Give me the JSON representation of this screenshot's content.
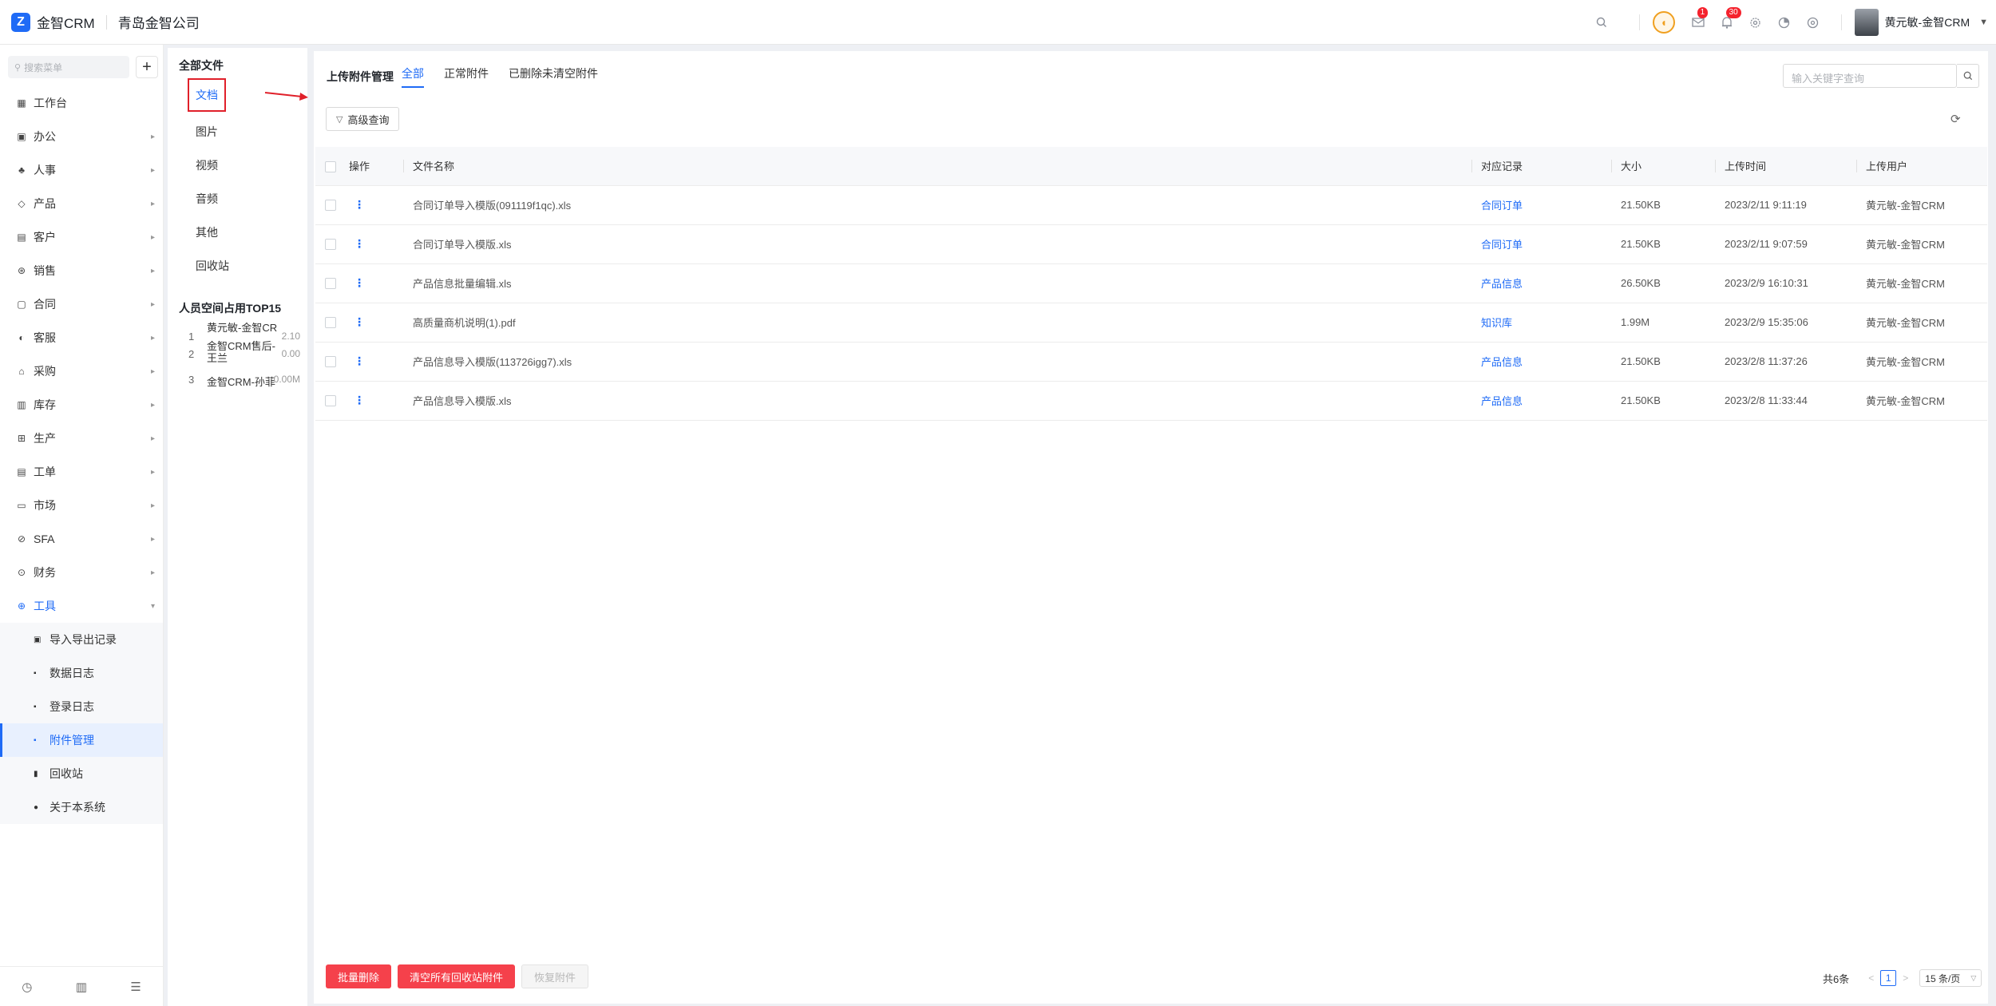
{
  "header": {
    "app_name": "金智CRM",
    "company": "青岛金智公司",
    "badge_messages": "1",
    "badge_notifications": "30",
    "user_name": "黄元敏-金智CRM"
  },
  "leftnav": {
    "search_placeholder": "搜索菜单",
    "add_label": "+",
    "items": [
      {
        "label": "工作台",
        "icon": "dashboard-icon"
      },
      {
        "label": "办公",
        "icon": "office-icon"
      },
      {
        "label": "人事",
        "icon": "hr-icon"
      },
      {
        "label": "产品",
        "icon": "product-icon"
      },
      {
        "label": "客户",
        "icon": "customer-icon"
      },
      {
        "label": "销售",
        "icon": "sales-icon"
      },
      {
        "label": "合同",
        "icon": "contract-icon"
      },
      {
        "label": "客服",
        "icon": "service-icon"
      },
      {
        "label": "采购",
        "icon": "purchase-icon"
      },
      {
        "label": "库存",
        "icon": "inventory-icon"
      },
      {
        "label": "生产",
        "icon": "production-icon"
      },
      {
        "label": "工单",
        "icon": "workorder-icon"
      },
      {
        "label": "市场",
        "icon": "market-icon"
      },
      {
        "label": "SFA",
        "icon": "sfa-icon"
      },
      {
        "label": "财务",
        "icon": "finance-icon"
      },
      {
        "label": "工具",
        "icon": "tools-icon"
      }
    ],
    "sub_items": [
      {
        "label": "导入导出记录"
      },
      {
        "label": "数据日志"
      },
      {
        "label": "登录日志"
      },
      {
        "label": "附件管理"
      },
      {
        "label": "回收站"
      },
      {
        "label": "关于本系统"
      }
    ]
  },
  "folders": {
    "title": "全部文件",
    "items": [
      "文档",
      "图片",
      "视频",
      "音频",
      "其他",
      "回收站"
    ],
    "top_title": "人员空间占用TOP15",
    "top_list": [
      {
        "rank": "1",
        "name": "黄元敏-金智CR",
        "size": "2.10"
      },
      {
        "rank": "2",
        "name": "金智CRM售后-王兰",
        "size": "0.00"
      },
      {
        "rank": "3",
        "name": "金智CRM-孙菲",
        "size": "0.00M"
      }
    ]
  },
  "main": {
    "title": "上传附件管理",
    "tabs": [
      "全部",
      "正常附件",
      "已删除未清空附件"
    ],
    "search_placeholder": "输入关键字查询",
    "advanced_label": "高级查询",
    "columns": [
      "操作",
      "文件名称",
      "对应记录",
      "大小",
      "上传时间",
      "上传用户"
    ],
    "rows": [
      {
        "name": "合同订单导入模版(091119f1qc).xls",
        "record": "合同订单",
        "size": "21.50KB",
        "time": "2023/2/11 9:11:19",
        "user": "黄元敏-金智CRM"
      },
      {
        "name": "合同订单导入模版.xls",
        "record": "合同订单",
        "size": "21.50KB",
        "time": "2023/2/11 9:07:59",
        "user": "黄元敏-金智CRM"
      },
      {
        "name": "产品信息批量编辑.xls",
        "record": "产品信息",
        "size": "26.50KB",
        "time": "2023/2/9 16:10:31",
        "user": "黄元敏-金智CRM"
      },
      {
        "name": "高质量商机说明(1).pdf",
        "record": "知识库",
        "size": "1.99M",
        "time": "2023/2/9 15:35:06",
        "user": "黄元敏-金智CRM"
      },
      {
        "name": "产品信息导入模版(113726igg7).xls",
        "record": "产品信息",
        "size": "21.50KB",
        "time": "2023/2/8 11:37:26",
        "user": "黄元敏-金智CRM"
      },
      {
        "name": "产品信息导入模版.xls",
        "record": "产品信息",
        "size": "21.50KB",
        "time": "2023/2/8 11:33:44",
        "user": "黄元敏-金智CRM"
      }
    ],
    "btn_batch_delete": "批量删除",
    "btn_clear_recycle": "清空所有回收站附件",
    "btn_restore": "恢复附件",
    "total": "共6条",
    "current_page": "1",
    "page_size": "15 条/页"
  },
  "colors": {
    "accent": "#1f6bf6",
    "danger": "#f5414b",
    "highlight_box": "#e0202a"
  }
}
